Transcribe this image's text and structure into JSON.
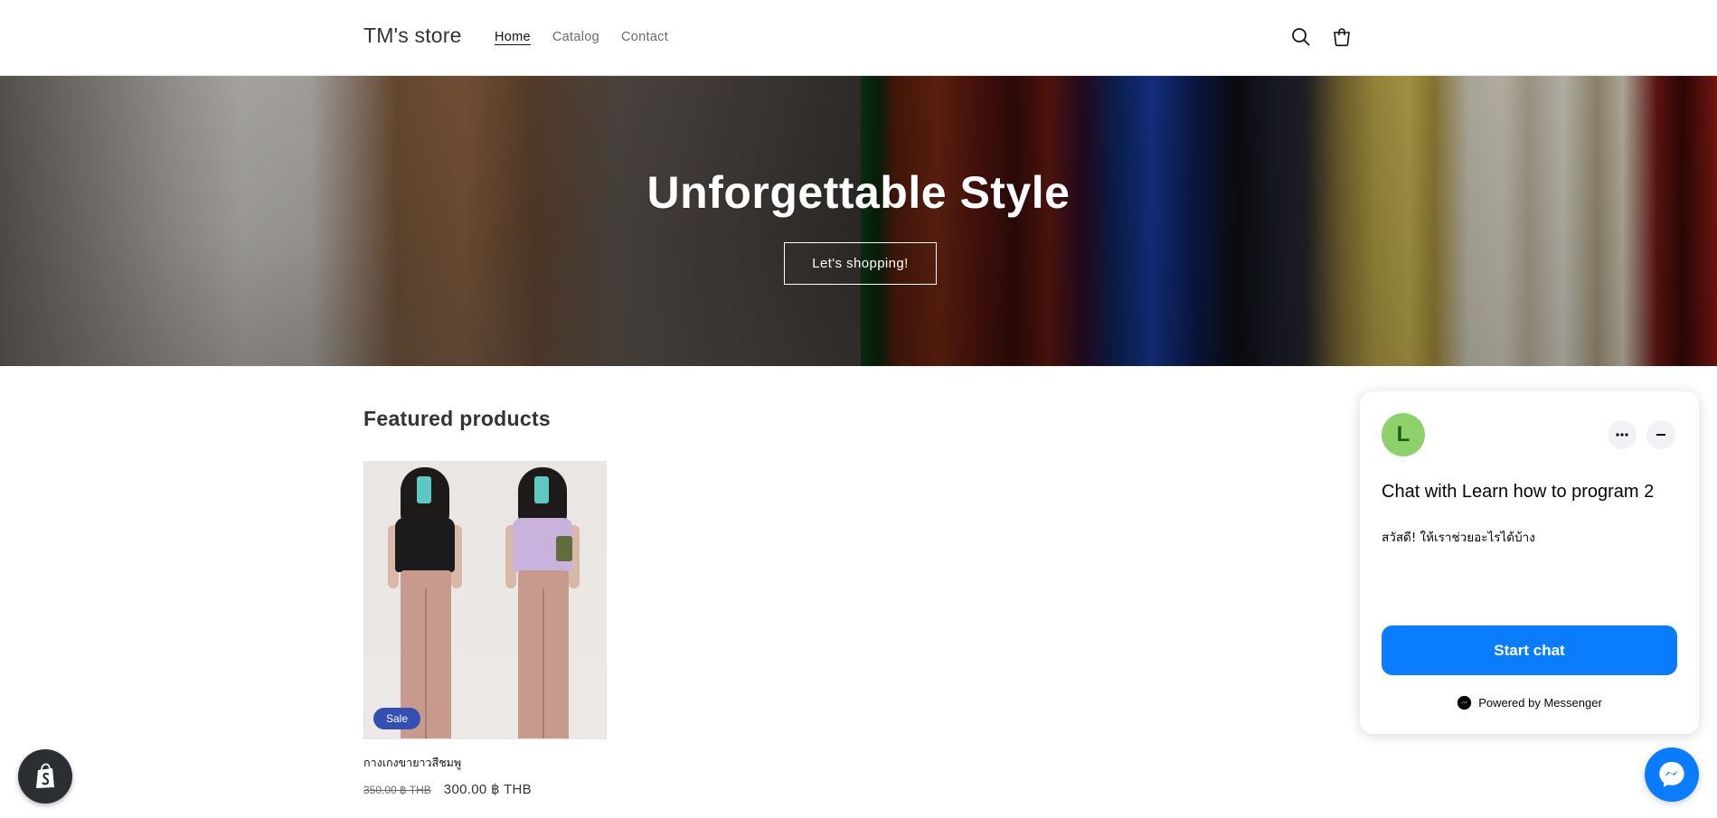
{
  "header": {
    "logo": "TM's store",
    "nav": [
      {
        "label": "Home",
        "active": true
      },
      {
        "label": "Catalog",
        "active": false
      },
      {
        "label": "Contact",
        "active": false
      }
    ],
    "icons": [
      "search-icon",
      "cart-icon"
    ]
  },
  "hero": {
    "title": "Unforgettable Style",
    "button_label": "Let's shopping!"
  },
  "featured": {
    "title": "Featured products",
    "products": [
      {
        "name": "กางเกงขายาวสีชมพู",
        "badge": "Sale",
        "price_old": "350.00 ฿ THB",
        "price_new": "300.00 ฿ THB"
      }
    ]
  },
  "chat": {
    "avatar_letter": "L",
    "title": "Chat with Learn how to program 2",
    "greeting": "สวัสดี! ให้เราช่วยอะไรได้บ้าง",
    "start_button": "Start chat",
    "powered_by": "Powered by Messenger"
  },
  "colors": {
    "accent_blue": "#0a7cff",
    "sale_badge": "#334fb4",
    "avatar_green": "#8ed06a"
  }
}
